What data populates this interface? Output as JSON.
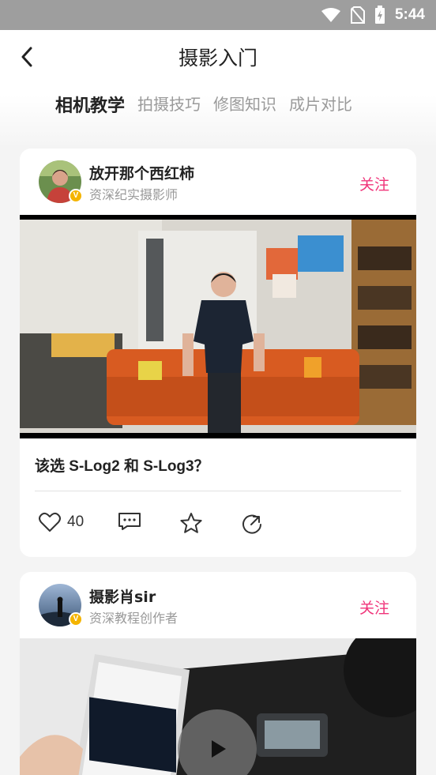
{
  "status_bar": {
    "time": "5:44",
    "icons": [
      "wifi-icon",
      "no-sim-icon",
      "battery-charging-icon"
    ]
  },
  "header": {
    "back_icon": "chevron-left-icon",
    "title": "摄影入门",
    "tabs": [
      {
        "label": "相机教学",
        "active": true
      },
      {
        "label": "拍摄技巧",
        "active": false
      },
      {
        "label": "修图知识",
        "active": false
      },
      {
        "label": "成片对比",
        "active": false
      }
    ]
  },
  "posts": [
    {
      "author": {
        "name": "放开那个西红柿",
        "subtitle": "资深纪实摄影师",
        "verified_badge": "V"
      },
      "follow_label": "关注",
      "title": "该选 S-Log2 和 S-Log3？",
      "like_count": "40",
      "action_icons": [
        "heart-icon",
        "comment-icon",
        "star-icon",
        "share-icon"
      ]
    },
    {
      "author": {
        "name": "摄影肖sir",
        "subtitle": "资深教程创作者",
        "verified_badge": "V"
      },
      "follow_label": "关注"
    }
  ],
  "colors": {
    "accent": "#f0347a",
    "badge": "#f4b400",
    "status_bar": "#9e9e9e"
  }
}
